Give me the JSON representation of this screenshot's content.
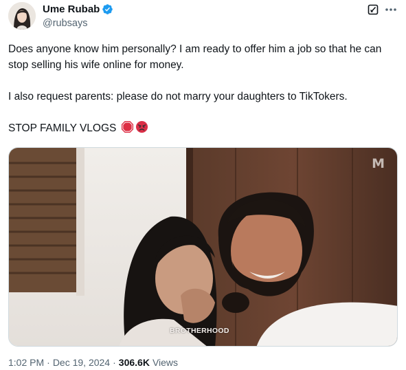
{
  "author": {
    "name": "Ume Rubab",
    "handle": "@rubsays",
    "verified": true
  },
  "tweet": {
    "paragraphs": [
      "Does anyone know him personally? I am ready to offer him a job so that he can stop selling his wife online for money.",
      "I also request parents: please do not marry your daughters to TikTokers.",
      "STOP FAMILY VLOGS"
    ],
    "emojis": [
      "stop-sign-emoji",
      "angry-face-emoji"
    ]
  },
  "media": {
    "watermark_logo": "M",
    "watermark_caption": "BROTHERHOOD"
  },
  "meta": {
    "time": "1:02 PM",
    "separator": "·",
    "date": "Dec 19, 2024",
    "views_count": "306.6K",
    "views_label": "Views"
  },
  "icons": {
    "verified": "verified-badge-icon",
    "grok": "grok-icon",
    "more": "more-options-icon"
  },
  "colors": {
    "text": "#0f1419",
    "secondary": "#536471",
    "verified_blue": "#1d9bf0",
    "border": "#cfd9de"
  }
}
